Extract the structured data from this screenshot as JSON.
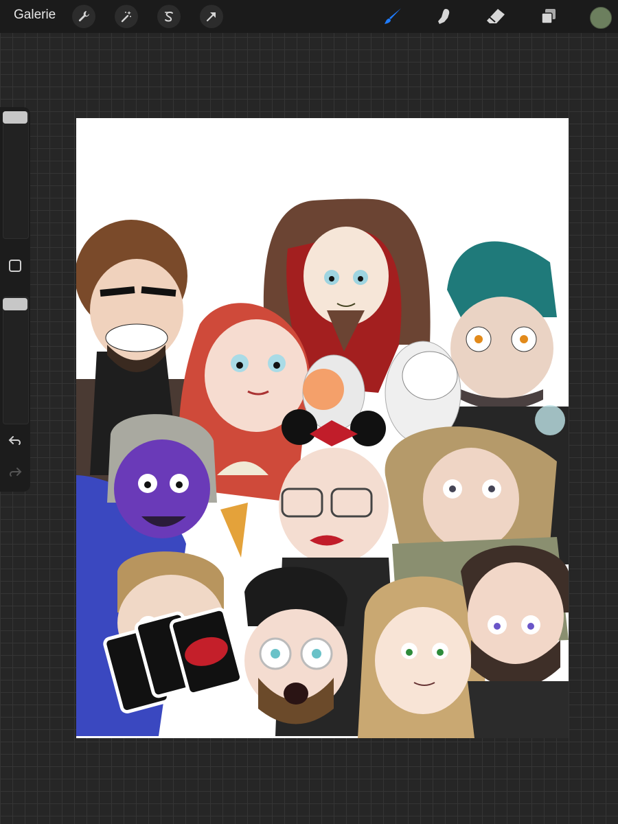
{
  "toolbar": {
    "gallery_label": "Galerie",
    "left_tools": [
      "wrench-icon",
      "magic-wand-icon",
      "selection-s-icon",
      "arrow-transform-icon"
    ],
    "right_tools": [
      "brush-icon",
      "smudge-icon",
      "eraser-icon",
      "layers-icon"
    ],
    "active_tool": "brush-icon",
    "active_tool_color": "#1f7cff",
    "current_color": "#6c7f5e"
  },
  "sidebar": {
    "brush_size": 0.9,
    "opacity": 1.0
  },
  "canvas": {
    "artwork": "caricature-group-illustration"
  }
}
